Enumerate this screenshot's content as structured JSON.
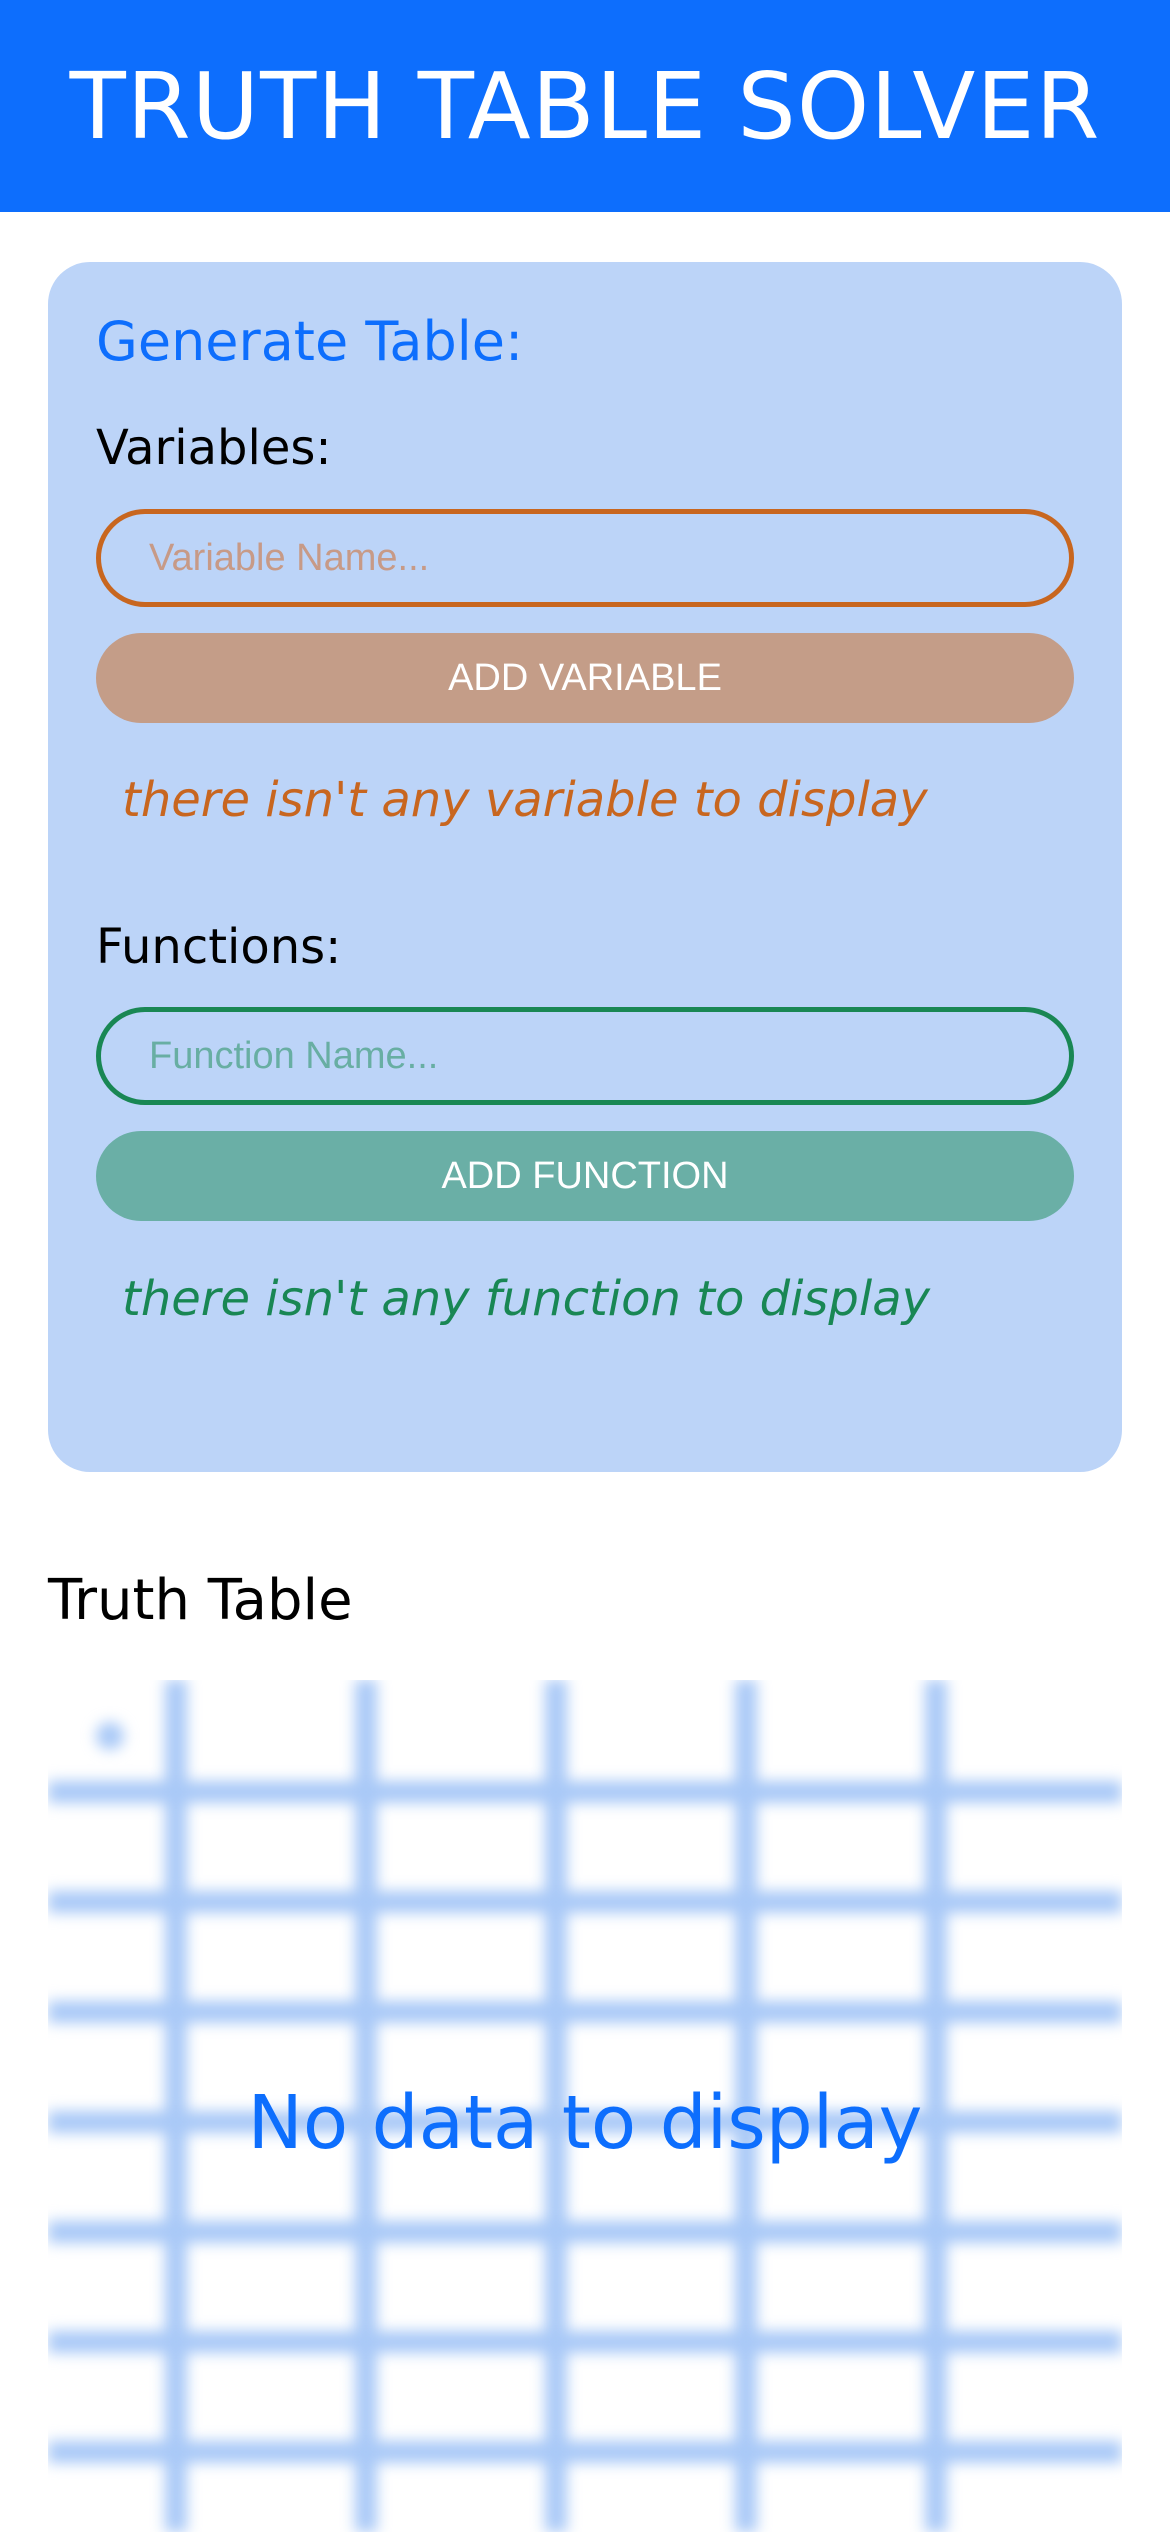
{
  "header": {
    "title": "TRUTH TABLE SOLVER"
  },
  "generator": {
    "title": "Generate Table:",
    "variables": {
      "label": "Variables:",
      "input_placeholder": "Variable Name...",
      "input_value": "",
      "button_label": "ADD VARIABLE",
      "empty_message": "there isn't any variable to display"
    },
    "functions": {
      "label": "Functions:",
      "input_placeholder": "Function Name...",
      "input_value": "",
      "button_label": "ADD FUNCTION",
      "empty_message": "there isn't any function to display"
    }
  },
  "truth_table": {
    "heading": "Truth Table",
    "empty_message": "No data to display"
  },
  "colors": {
    "primary": "#0d6efd",
    "panel_bg": "#bcd4f8",
    "variable_accent": "#c8661f",
    "variable_button": "#c49d88",
    "function_accent": "#198754",
    "function_button": "#6aafa6",
    "grid_placeholder": "#a9c9f7"
  }
}
